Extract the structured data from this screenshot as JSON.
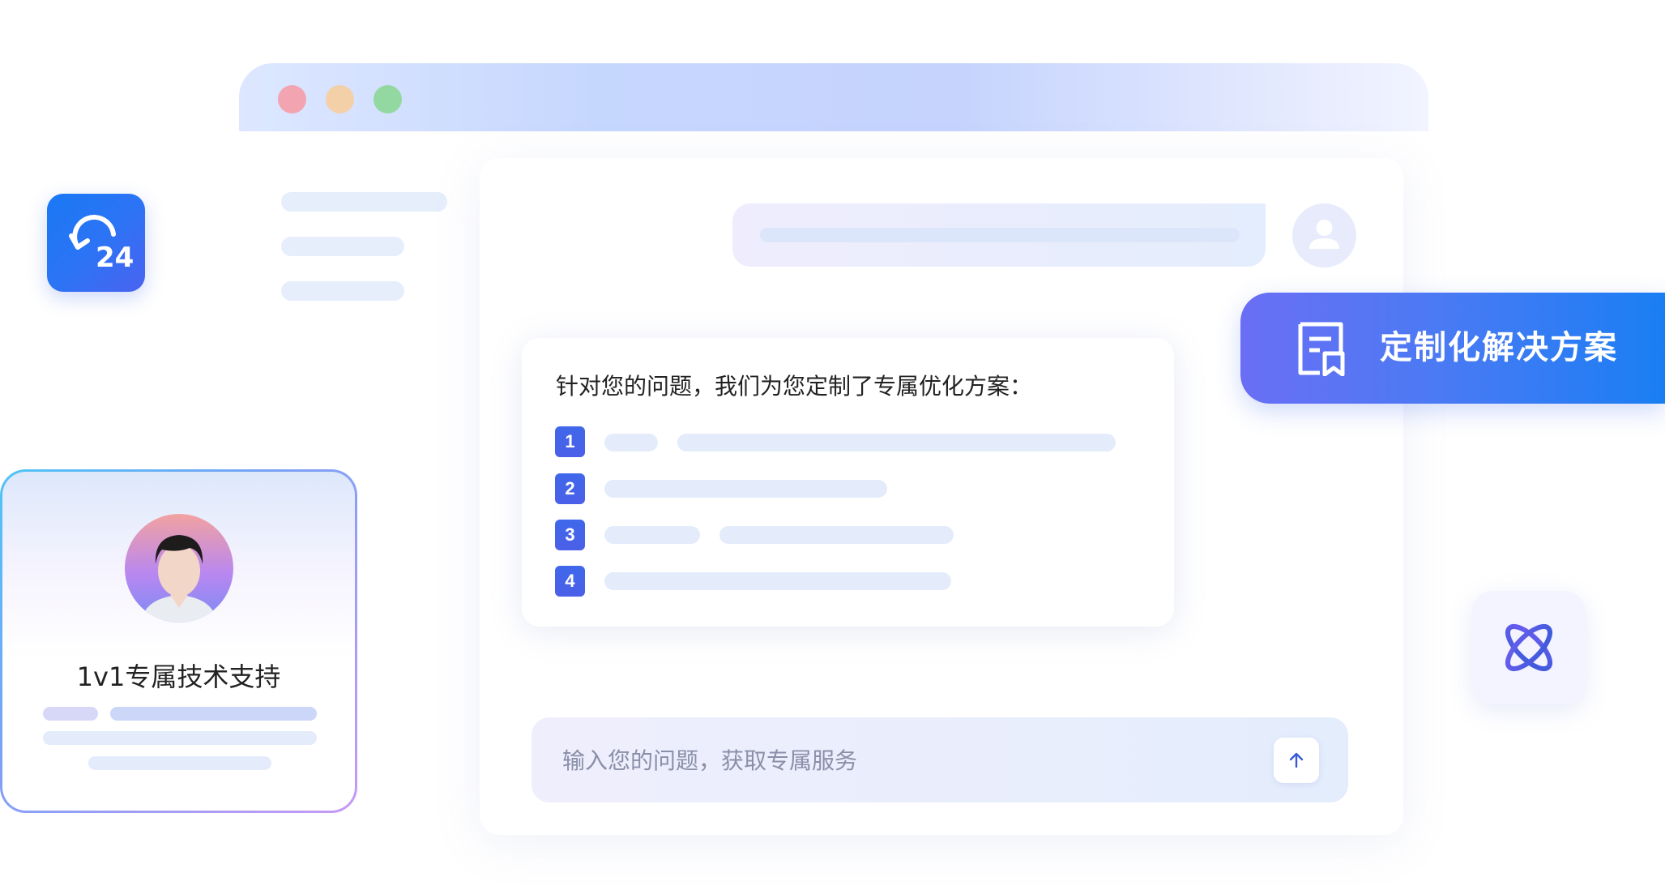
{
  "window": {
    "controls": [
      "close",
      "minimize",
      "maximize"
    ]
  },
  "chat": {
    "answer_title": "针对您的问题，我们为您定制了专属优化方案：",
    "steps": [
      "1",
      "2",
      "3",
      "4"
    ],
    "input_placeholder": "输入您的问题，获取专属服务"
  },
  "solution_pill": {
    "label": "定制化解决方案"
  },
  "badge": {
    "text": "24"
  },
  "support_card": {
    "title": "1v1专属技术支持"
  },
  "icons": {
    "badge": "clock-24h-icon",
    "solution": "document-bookmark-icon",
    "atom": "atom-icon",
    "user": "user-icon",
    "send": "arrow-up-icon"
  },
  "colors": {
    "accent_blue": "#1a7ef3",
    "accent_indigo": "#4b5fe8",
    "skeleton": "#e6eefc"
  }
}
